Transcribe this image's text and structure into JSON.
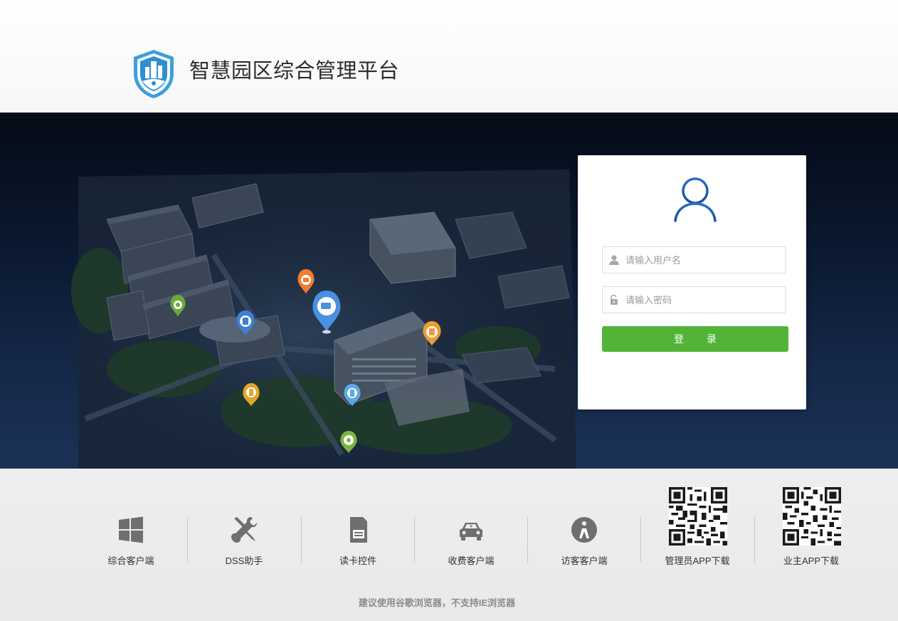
{
  "header": {
    "title": "智慧园区综合管理平台",
    "logo_icon": "shield-building-icon"
  },
  "hero": {
    "map_pins": [
      {
        "name": "camera-pin",
        "color": "#4a90e2"
      },
      {
        "name": "broadcast-pin",
        "color": "#ef7d32"
      },
      {
        "name": "environment-pin",
        "color": "#6aaa3a"
      },
      {
        "name": "access-control-pin",
        "color": "#3f7fd6"
      },
      {
        "name": "document-pin",
        "color": "#f19a35"
      },
      {
        "name": "parking-pin",
        "color": "#e0a72e"
      },
      {
        "name": "visitor-pin",
        "color": "#5aa9e6"
      },
      {
        "name": "patrol-pin",
        "color": "#7cb342"
      }
    ]
  },
  "login": {
    "avatar_icon": "user-avatar-icon",
    "username_placeholder": "请输入用户名",
    "username_value": "",
    "password_placeholder": "请输入密码",
    "password_value": "",
    "submit_label": "登 录",
    "accent_color": "#53b337"
  },
  "footer": {
    "downloads": [
      {
        "label": "综合客户端",
        "icon": "windows-icon"
      },
      {
        "label": "DSS助手",
        "icon": "tools-icon"
      },
      {
        "label": "读卡控件",
        "icon": "sim-card-icon"
      },
      {
        "label": "收费客户端",
        "icon": "car-fee-icon"
      },
      {
        "label": "访客客户端",
        "icon": "visitor-icon"
      },
      {
        "label": "管理员APP下载",
        "icon": "qr-code-icon"
      },
      {
        "label": "业主APP下载",
        "icon": "qr-code-icon"
      }
    ],
    "browser_note": "建议使用谷歌浏览器，不支持IE浏览器"
  }
}
